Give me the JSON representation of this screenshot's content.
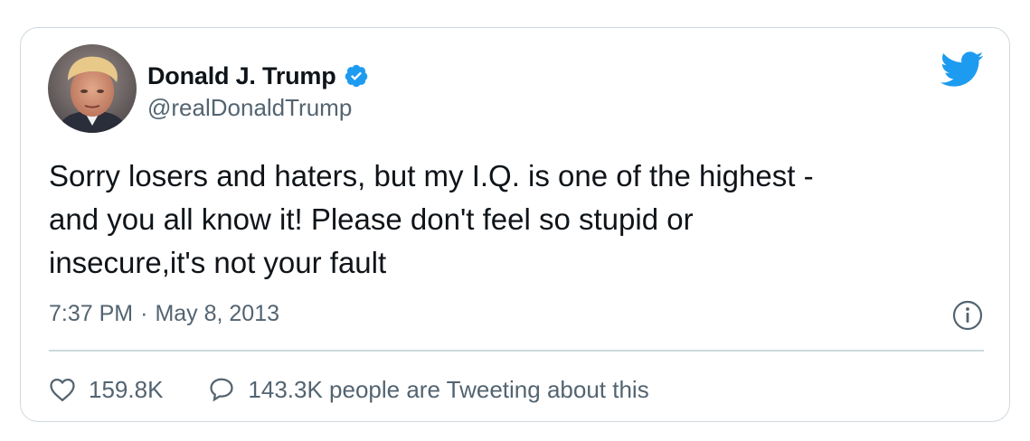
{
  "author": {
    "display_name": "Donald J. Trump",
    "handle": "@realDonaldTrump",
    "verified": true
  },
  "tweet": {
    "text": "Sorry losers and haters, but my I.Q. is one of the highest -\nand you all know it! Please don't feel so stupid or\ninsecure,it's not your fault",
    "time": "7:37 PM",
    "separator": "·",
    "date": "May 8, 2013"
  },
  "actions": {
    "likes": "159.8K",
    "conversation": "143.3K people are Tweeting about this"
  },
  "icons": {
    "brand": "twitter-bird-icon",
    "verified": "verified-badge-icon",
    "info": "info-icon",
    "like": "heart-icon",
    "reply": "speech-bubble-icon"
  },
  "colors": {
    "brand_blue": "#1d9bf0",
    "text_primary": "#0f1419",
    "text_secondary": "#536471",
    "border": "#cfd9de"
  }
}
